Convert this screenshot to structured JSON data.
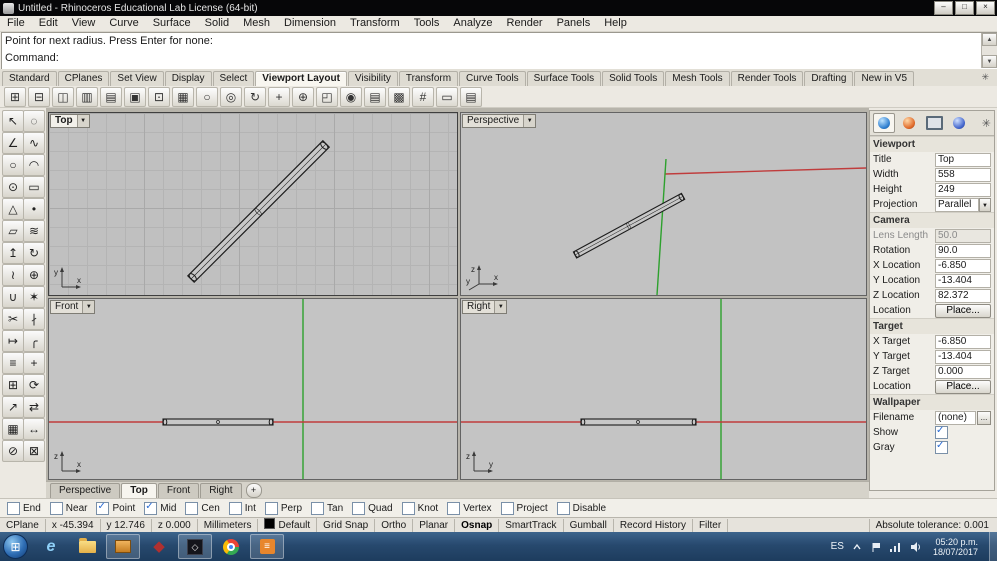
{
  "window": {
    "title": "Untitled - Rhinoceros Educational Lab License (64-bit)",
    "minimize": "–",
    "restore": "□",
    "close": "×"
  },
  "menu": {
    "items": [
      "File",
      "Edit",
      "View",
      "Curve",
      "Surface",
      "Solid",
      "Mesh",
      "Dimension",
      "Transform",
      "Tools",
      "Analyze",
      "Render",
      "Panels",
      "Help"
    ]
  },
  "command": {
    "history_line": "Point for next radius. Press Enter for none:",
    "prompt": "Command:"
  },
  "ui": {
    "dd_arrow": "▼",
    "scroll_up": "▲",
    "scroll_down": "▼",
    "ellipsis": "...",
    "plus": "+",
    "start_glyph": "⊞",
    "gear": "✳"
  },
  "toolbar": {
    "tabs": [
      {
        "label": "Standard"
      },
      {
        "label": "CPlanes"
      },
      {
        "label": "Set View"
      },
      {
        "label": "Display"
      },
      {
        "label": "Select"
      },
      {
        "label": "Viewport Layout",
        "active": true
      },
      {
        "label": "Visibility"
      },
      {
        "label": "Transform"
      },
      {
        "label": "Curve Tools"
      },
      {
        "label": "Surface Tools"
      },
      {
        "label": "Solid Tools"
      },
      {
        "label": "Mesh Tools"
      },
      {
        "label": "Render Tools"
      },
      {
        "label": "Drafting"
      },
      {
        "label": "New in V5"
      }
    ],
    "icons": [
      {
        "name": "viewport-layout-4-icon",
        "glyph": "⊞"
      },
      {
        "name": "viewport-layout-2h-icon",
        "glyph": "⊟"
      },
      {
        "name": "viewport-layout-2v-icon",
        "glyph": "◫"
      },
      {
        "name": "viewport-layout-3-icon",
        "glyph": "▥"
      },
      {
        "name": "viewport-split-icon",
        "glyph": "▤"
      },
      {
        "name": "viewport-maximize-icon",
        "glyph": "▣"
      },
      {
        "name": "viewport-float-icon",
        "glyph": "⊡"
      },
      {
        "name": "viewport-properties-icon",
        "glyph": "▦"
      },
      {
        "name": "zoom-window-icon",
        "glyph": "○"
      },
      {
        "name": "zoom-dynamic-icon",
        "glyph": "◎"
      },
      {
        "name": "rotate-view-icon",
        "glyph": "↻"
      },
      {
        "name": "pan-view-icon",
        "glyph": "+"
      },
      {
        "name": "zoom-extents-icon",
        "glyph": "⊕"
      },
      {
        "name": "set-cplane-icon",
        "glyph": "◰"
      },
      {
        "name": "camera-icon",
        "glyph": "◉"
      },
      {
        "name": "named-view-icon",
        "glyph": "▤"
      },
      {
        "name": "background-bitmap-icon",
        "glyph": "▩"
      },
      {
        "name": "grid-options-icon",
        "glyph": "#"
      },
      {
        "name": "page-layout-icon",
        "glyph": "▭"
      },
      {
        "name": "print-icon",
        "glyph": "▤"
      }
    ]
  },
  "sidebar": {
    "tools": [
      {
        "name": "select-icon",
        "glyph": "↖"
      },
      {
        "name": "lasso-select-icon",
        "glyph": "◌"
      },
      {
        "name": "polyline-icon",
        "glyph": "∠"
      },
      {
        "name": "curve-icon",
        "glyph": "∿"
      },
      {
        "name": "circle-icon",
        "glyph": "○"
      },
      {
        "name": "arc-icon",
        "glyph": "◠"
      },
      {
        "name": "ellipse-icon",
        "glyph": "⊙"
      },
      {
        "name": "rectangle-icon",
        "glyph": "▭"
      },
      {
        "name": "polygon-icon",
        "glyph": "△"
      },
      {
        "name": "point-icon",
        "glyph": "•"
      },
      {
        "name": "plane-icon",
        "glyph": "▱"
      },
      {
        "name": "loft-icon",
        "glyph": "≋"
      },
      {
        "name": "extrude-icon",
        "glyph": "↥"
      },
      {
        "name": "revolve-icon",
        "glyph": "↻"
      },
      {
        "name": "sweep-icon",
        "glyph": "≀"
      },
      {
        "name": "boolean-icon",
        "glyph": "⊕"
      },
      {
        "name": "join-icon",
        "glyph": "∪"
      },
      {
        "name": "explode-icon",
        "glyph": "✶"
      },
      {
        "name": "trim-icon",
        "glyph": "✂"
      },
      {
        "name": "split-icon",
        "glyph": "∤"
      },
      {
        "name": "extend-icon",
        "glyph": "↦"
      },
      {
        "name": "fillet-icon",
        "glyph": "╭"
      },
      {
        "name": "offset-icon",
        "glyph": "≡"
      },
      {
        "name": "move-icon",
        "glyph": "+"
      },
      {
        "name": "copy-icon",
        "glyph": "⊞"
      },
      {
        "name": "rotate-icon",
        "glyph": "⟳"
      },
      {
        "name": "scale-icon",
        "glyph": "↗"
      },
      {
        "name": "mirror-icon",
        "glyph": "⇄"
      },
      {
        "name": "array-icon",
        "glyph": "▦"
      },
      {
        "name": "dimension-icon",
        "glyph": "↔"
      },
      {
        "name": "hide-icon",
        "glyph": "⊘"
      },
      {
        "name": "lock-icon",
        "glyph": "⊠"
      }
    ]
  },
  "viewports": {
    "top": {
      "label": "Top",
      "axis_v": "y",
      "axis_h": "x"
    },
    "perspective": {
      "label": "Perspective",
      "axis_v": "z",
      "axis_h": "x",
      "axis_d": "y"
    },
    "front": {
      "label": "Front",
      "axis_v": "z",
      "axis_h": "x"
    },
    "right": {
      "label": "Right",
      "axis_v": "z",
      "axis_h": "y"
    }
  },
  "viewport_tabs": {
    "items": [
      {
        "label": "Perspective"
      },
      {
        "label": "Top",
        "active": true
      },
      {
        "label": "Front"
      },
      {
        "label": "Right"
      }
    ]
  },
  "panel": {
    "rows": [
      {
        "label": "Viewport"
      },
      {
        "label": "Title",
        "value": "Top"
      },
      {
        "label": "Width",
        "value": "558"
      },
      {
        "label": "Height",
        "value": "249"
      },
      {
        "label": "Projection",
        "value": "Parallel"
      },
      {
        "label": "Camera"
      },
      {
        "label": "Lens Length",
        "value": "50.0",
        "disabled": true
      },
      {
        "label": "Rotation",
        "value": "90.0"
      },
      {
        "label": "X Location",
        "value": "-6.850"
      },
      {
        "label": "Y Location",
        "value": "-13.404"
      },
      {
        "label": "Z Location",
        "value": "82.372"
      },
      {
        "label": "Location",
        "value": "Place..."
      },
      {
        "label": "Target"
      },
      {
        "label": "X Target",
        "value": "-6.850"
      },
      {
        "label": "Y Target",
        "value": "-13.404"
      },
      {
        "label": "Z Target",
        "value": "0.000"
      },
      {
        "label": "Location",
        "value": "Place..."
      },
      {
        "label": "Wallpaper"
      },
      {
        "label": "Filename",
        "value": "(none)"
      },
      {
        "label": "Show",
        "checked": true
      },
      {
        "label": "Gray",
        "checked": true
      }
    ]
  },
  "osnap": {
    "items": [
      {
        "label": "End"
      },
      {
        "label": "Near"
      },
      {
        "label": "Point",
        "checked": true
      },
      {
        "label": "Mid",
        "checked": true
      },
      {
        "label": "Cen"
      },
      {
        "label": "Int"
      },
      {
        "label": "Perp"
      },
      {
        "label": "Tan"
      },
      {
        "label": "Quad"
      },
      {
        "label": "Knot"
      },
      {
        "label": "Vertex"
      },
      {
        "label": "Project"
      },
      {
        "label": "Disable"
      }
    ]
  },
  "status": {
    "cplane": "CPlane",
    "x": "x -45.394",
    "y": "y 12.746",
    "z": "z 0.000",
    "units": "Millimeters",
    "layer": "Default",
    "panes": [
      {
        "label": "Grid Snap"
      },
      {
        "label": "Ortho"
      },
      {
        "label": "Planar"
      },
      {
        "label": "Osnap",
        "active": true
      },
      {
        "label": "SmartTrack"
      },
      {
        "label": "Gumball"
      },
      {
        "label": "Record History"
      },
      {
        "label": "Filter"
      }
    ],
    "tolerance": "Absolute tolerance: 0.001"
  },
  "taskbar": {
    "language": "ES",
    "time": "05:20 p.m.",
    "date": "18/07/2017",
    "apps": [
      {
        "name": "ie-icon",
        "glyph": "e"
      },
      {
        "name": "file-explorer-icon",
        "glyph": ""
      },
      {
        "name": "tool-app-icon",
        "glyph": ""
      },
      {
        "name": "setup-app-icon",
        "glyph": "◆"
      },
      {
        "name": "rhino-app-icon",
        "glyph": "◇"
      },
      {
        "name": "chrome-icon",
        "glyph": ""
      },
      {
        "name": "writer-app-icon",
        "glyph": "≡"
      }
    ]
  },
  "theme": {
    "axis_x": "#c03c3c",
    "axis_y": "#2da12d",
    "object_fill": "#c8c8c8",
    "object_stroke": "#1c1c1c"
  }
}
